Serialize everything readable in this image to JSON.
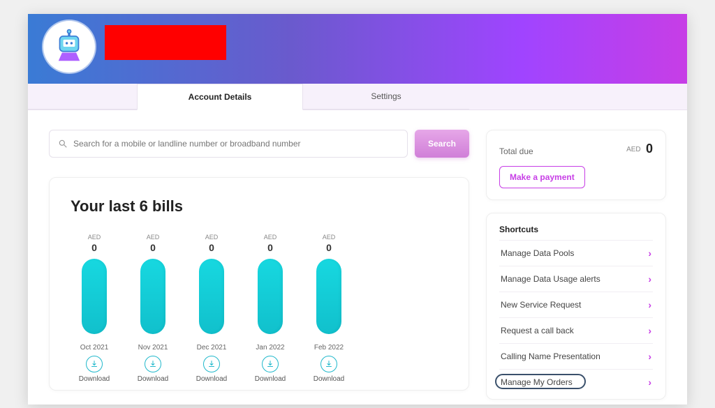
{
  "header": {
    "redacted_block": true
  },
  "tabs": {
    "active": "Account Details",
    "inactive": "Settings"
  },
  "search": {
    "placeholder": "Search for a mobile or landline number or broadband number",
    "button": "Search"
  },
  "bills": {
    "title": "Your last 6 bills",
    "currency": "AED",
    "items": [
      {
        "month": "Oct 2021",
        "value": "0",
        "download": "Download"
      },
      {
        "month": "Nov 2021",
        "value": "0",
        "download": "Download"
      },
      {
        "month": "Dec 2021",
        "value": "0",
        "download": "Download"
      },
      {
        "month": "Jan 2022",
        "value": "0",
        "download": "Download"
      },
      {
        "month": "Feb 2022",
        "value": "0",
        "download": "Download"
      }
    ]
  },
  "totals": {
    "label": "Total due",
    "currency": "AED",
    "amount": "0",
    "pay_button": "Make a payment"
  },
  "shortcuts": {
    "title": "Shortcuts",
    "items": [
      "Manage Data Pools",
      "Manage Data Usage alerts",
      "New Service Request",
      "Request a call back",
      "Calling Name Presentation",
      "Manage My Orders"
    ],
    "highlight_index": 5
  },
  "chart_data": {
    "type": "bar",
    "categories": [
      "Oct 2021",
      "Nov 2021",
      "Dec 2021",
      "Jan 2022",
      "Feb 2022"
    ],
    "values": [
      0,
      0,
      0,
      0,
      0
    ],
    "title": "Your last 6 bills",
    "xlabel": "",
    "ylabel": "AED",
    "ylim": [
      0,
      0
    ]
  }
}
